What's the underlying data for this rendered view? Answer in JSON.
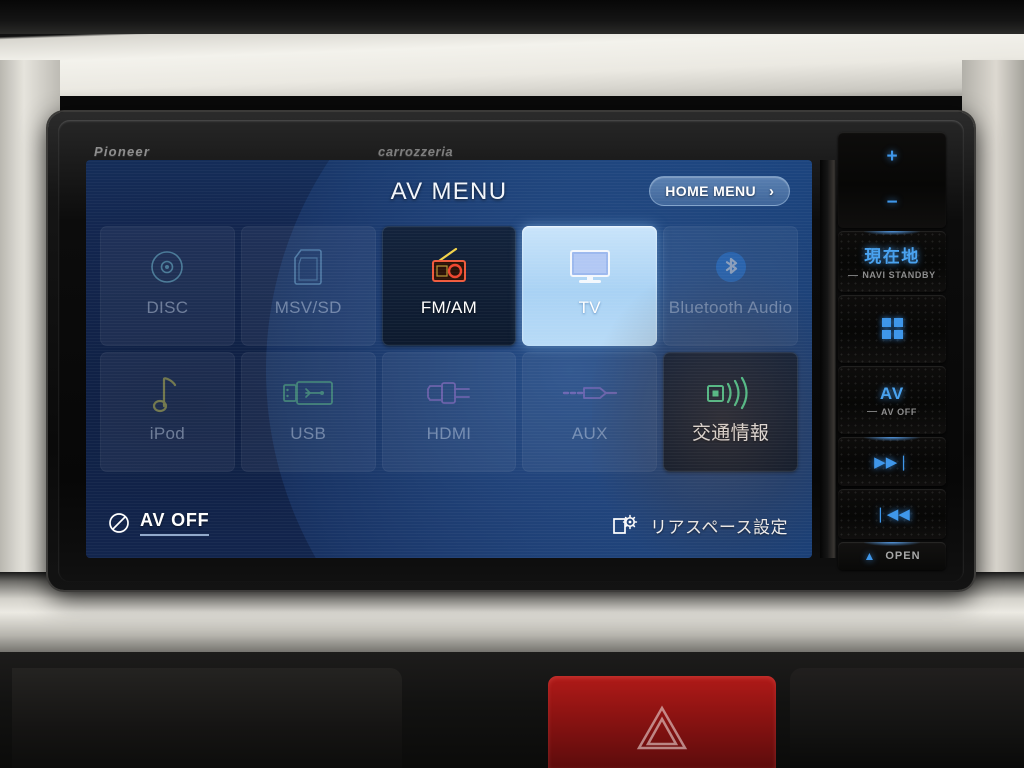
{
  "head_unit": {
    "brand_left": "Pioneer",
    "brand_right": "carrozzeria"
  },
  "screen": {
    "title": "AV MENU",
    "home_menu": {
      "label": "HOME MENU",
      "chevron": "›"
    },
    "tiles": [
      {
        "label": "DISC",
        "icon": "disc-icon",
        "state": "dim"
      },
      {
        "label": "MSV/SD",
        "icon": "sd-card-icon",
        "state": "dim"
      },
      {
        "label": "FM/AM",
        "icon": "radio-icon",
        "state": "active"
      },
      {
        "label": "TV",
        "icon": "tv-icon",
        "state": "selected"
      },
      {
        "label": "Bluetooth Audio",
        "icon": "bluetooth-icon",
        "state": "dim"
      },
      {
        "label": "iPod",
        "icon": "music-note-icon",
        "state": "dim"
      },
      {
        "label": "USB",
        "icon": "usb-icon",
        "state": "dim"
      },
      {
        "label": "HDMI",
        "icon": "hdmi-icon",
        "state": "dim"
      },
      {
        "label": "AUX",
        "icon": "aux-plug-icon",
        "state": "dim"
      },
      {
        "label": "交通情報",
        "icon": "broadcast-icon",
        "state": "active"
      }
    ],
    "av_off": {
      "label": "AV OFF",
      "icon": "circle-x-icon"
    },
    "rear_space": {
      "label": "リアスペース設定",
      "icon": "rear-space-gear-icon"
    }
  },
  "hard_keys": {
    "volume_up": "+",
    "volume_down": "−",
    "current_location": "現在地",
    "current_location_sub": "NAVI STANDBY",
    "grid_menu": "grid-icon",
    "av": "AV",
    "av_sub": "AV OFF",
    "next_track": "▶▶❘",
    "prev_track": "❘◀◀",
    "eject": "OPEN",
    "eject_sub": "▲"
  },
  "colors": {
    "screen_blue": "#15325f",
    "selected_tile": "#a9d2f4",
    "key_glow": "#3f97ea",
    "hazard_red": "#8d1312"
  }
}
